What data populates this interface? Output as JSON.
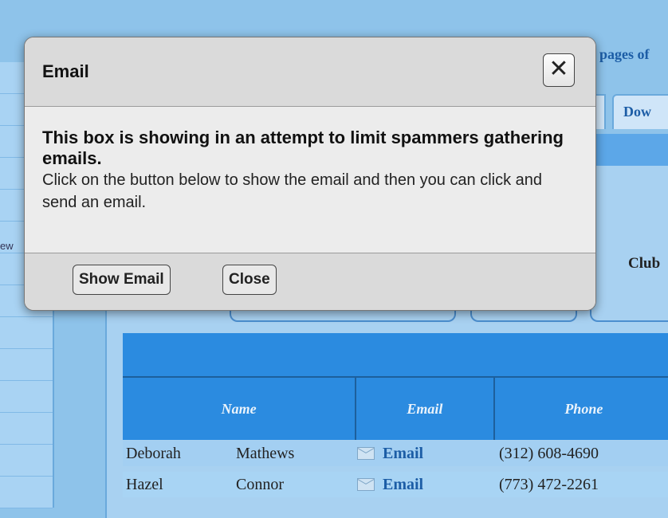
{
  "background": {
    "top_link_fragment": "pages of",
    "tab_fragment": "Dow",
    "club_fragment": "Club",
    "left_fragment": "ew",
    "table": {
      "headers": [
        "Name",
        "Email",
        "Phone"
      ],
      "rows": [
        {
          "first": "Deborah",
          "last": "Mathews",
          "email_label": "Email",
          "phone": "(312) 608-4690"
        },
        {
          "first": "Hazel",
          "last": "Connor",
          "email_label": "Email",
          "phone": "(773) 472-2261"
        }
      ]
    }
  },
  "modal": {
    "title": "Email",
    "close_glyph": "✕",
    "message_strong": "This box is showing in an attempt to limit spammers gathering emails.",
    "message_text": "Click on the button below to show the email and then you can click and send an email.",
    "show_button": "Show Email",
    "close_button": "Close"
  }
}
